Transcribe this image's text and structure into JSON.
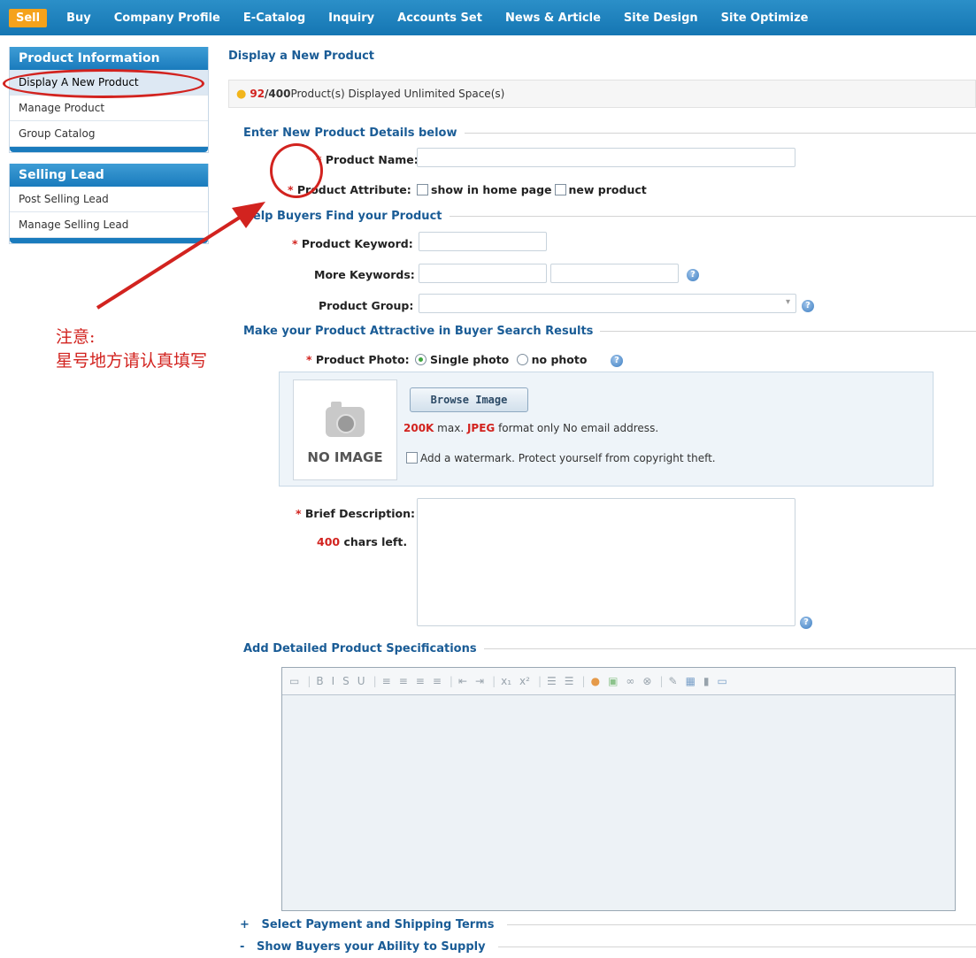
{
  "topnav": {
    "items": [
      "Sell",
      "Buy",
      "Company Profile",
      "E-Catalog",
      "Inquiry",
      "Accounts Set",
      "News & Article",
      "Site Design",
      "Site Optimize"
    ]
  },
  "sidebar": {
    "box1": {
      "title": "Product Information",
      "items": [
        "Display A New Product",
        "Manage Product",
        "Group Catalog"
      ]
    },
    "box2": {
      "title": "Selling Lead",
      "items": [
        "Post Selling Lead",
        "Manage Selling Lead"
      ]
    }
  },
  "annotation": {
    "line1": "注意:",
    "line2": "星号地方请认真填写"
  },
  "main": {
    "title": "Display a New Product",
    "tip": {
      "count": "92",
      "total": "/400",
      "text": " Product(s) Displayed Unlimited Space(s)"
    },
    "sections": {
      "details": "Enter New Product Details below",
      "help": "Help Buyers Find your Product",
      "attractive": "Make your Product Attractive in Buyer Search Results",
      "specs": "Add Detailed Product Specifications"
    },
    "labels": {
      "product_name": "Product Name:",
      "product_attribute": "Product Attribute:",
      "show_home": "show in home page",
      "new_product": "new product",
      "keyword": "Product Keyword:",
      "more_keywords": "More Keywords:",
      "group": "Product Group:",
      "photo": "Product Photo:",
      "single_photo": "Single photo",
      "no_photo": "no photo",
      "brief": "Brief Description:",
      "chars_count": "400",
      "chars_text": " chars left."
    },
    "photo": {
      "no_image": "NO IMAGE",
      "browse": "Browse Image",
      "size": "200K",
      "size_text": " max. ",
      "format": "JPEG",
      "format_text": " format only No email address.",
      "watermark": "Add a watermark. Protect yourself from copyright theft."
    },
    "collapse": {
      "payment": "+   Select Payment and Shipping Terms",
      "supply": "-   Show Buyers your Ability to Supply"
    }
  }
}
